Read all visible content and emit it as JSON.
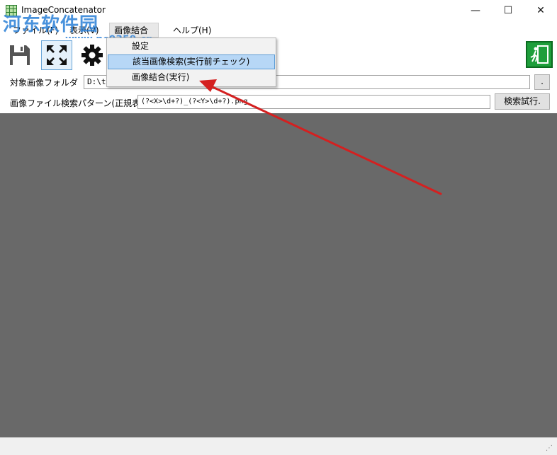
{
  "window": {
    "title": "ImageConcatenator",
    "minimize": "—",
    "maximize": "☐",
    "close": "✕"
  },
  "watermark": {
    "text": "河东软件园",
    "url": "www.pc0359.cn"
  },
  "menu": {
    "file": "ファイル(F)",
    "view": "表示(V)",
    "combine": "画像結合(C)",
    "help": "ヘルプ(H)"
  },
  "dropdown": {
    "items": [
      {
        "label": "設定"
      },
      {
        "label": "該当画像検索(実行前チェック)"
      },
      {
        "label": "画像結合(実行)"
      }
    ]
  },
  "form": {
    "folder_label": "対象画像フォルダ",
    "folder_value": "D:\\to",
    "browse_label": ".",
    "pattern_label": "画像ファイル検索パターン(正規表",
    "pattern_value": "(?<X>\\d+?)_(?<Y>\\d+?).png",
    "search_label": "検索試行."
  },
  "colors": {
    "canvas": "#696969",
    "highlight": "#b7d7f6",
    "arrow": "#d42020",
    "exit": "#1e9e3b",
    "watermark": "#2a7fd6"
  },
  "icons": [
    "app-grid-icon",
    "save-icon",
    "fullscreen-icon",
    "gear-icon",
    "exit-icon"
  ]
}
